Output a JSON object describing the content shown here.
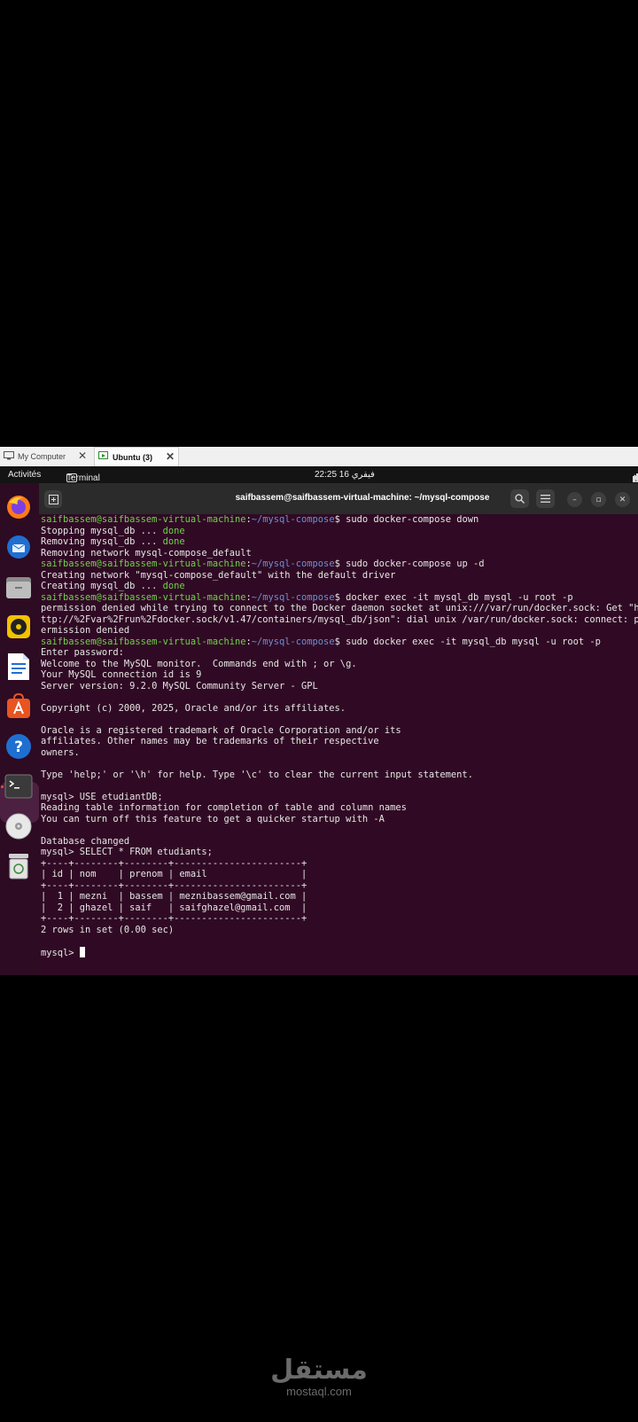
{
  "vm_tabs": [
    {
      "label": "My Computer",
      "icon": "monitor-icon"
    },
    {
      "label": "Ubuntu (3)",
      "icon": "vm-running-icon"
    }
  ],
  "topbar": {
    "activities": "Activités",
    "app_name": "Terminal",
    "clock": "22:25  16 فيفري",
    "tray_icons": [
      "network-icon",
      "volume-icon",
      "power-icon"
    ]
  },
  "dock": {
    "items": [
      "firefox-icon",
      "thunderbird-icon",
      "files-icon",
      "rhythmbox-icon",
      "writer-icon",
      "app-center-icon",
      "help-icon",
      "terminal-icon",
      "dvd-icon",
      "trash-icon"
    ],
    "active": "terminal-icon"
  },
  "terminal": {
    "title": "saifbassem@saifbassem-virtual-machine: ~/mysql-compose",
    "prompt_user": "saifbassem@saifbassem-virtual-machine",
    "prompt_path": "~/mysql-compose",
    "lines": [
      {
        "type": "prompt",
        "cmd": "sudo docker-compose down"
      },
      {
        "type": "status",
        "text": "Stopping mysql_db ... ",
        "status": "done"
      },
      {
        "type": "status",
        "text": "Removing mysql_db ... ",
        "status": "done"
      },
      {
        "type": "out",
        "text": "Removing network mysql-compose_default"
      },
      {
        "type": "prompt",
        "cmd": "sudo docker-compose up -d"
      },
      {
        "type": "out",
        "text": "Creating network \"mysql-compose_default\" with the default driver"
      },
      {
        "type": "status",
        "text": "Creating mysql_db ... ",
        "status": "done"
      },
      {
        "type": "prompt",
        "cmd": "docker exec -it mysql_db mysql -u root -p"
      },
      {
        "type": "out",
        "text": "permission denied while trying to connect to the Docker daemon socket at unix:///var/run/docker.sock: Get \"h"
      },
      {
        "type": "out",
        "text": "ttp://%2Fvar%2Frun%2Fdocker.sock/v1.47/containers/mysql_db/json\": dial unix /var/run/docker.sock: connect: p"
      },
      {
        "type": "out",
        "text": "ermission denied"
      },
      {
        "type": "prompt",
        "cmd": "sudo docker exec -it mysql_db mysql -u root -p"
      },
      {
        "type": "out",
        "text": "Enter password:"
      },
      {
        "type": "out",
        "text": "Welcome to the MySQL monitor.  Commands end with ; or \\g."
      },
      {
        "type": "out",
        "text": "Your MySQL connection id is 9"
      },
      {
        "type": "out",
        "text": "Server version: 9.2.0 MySQL Community Server - GPL"
      },
      {
        "type": "out",
        "text": ""
      },
      {
        "type": "out",
        "text": "Copyright (c) 2000, 2025, Oracle and/or its affiliates."
      },
      {
        "type": "out",
        "text": ""
      },
      {
        "type": "out",
        "text": "Oracle is a registered trademark of Oracle Corporation and/or its"
      },
      {
        "type": "out",
        "text": "affiliates. Other names may be trademarks of their respective"
      },
      {
        "type": "out",
        "text": "owners."
      },
      {
        "type": "out",
        "text": ""
      },
      {
        "type": "out",
        "text": "Type 'help;' or '\\h' for help. Type '\\c' to clear the current input statement."
      },
      {
        "type": "out",
        "text": ""
      },
      {
        "type": "out",
        "text": "mysql> USE etudiantDB;"
      },
      {
        "type": "out",
        "text": "Reading table information for completion of table and column names"
      },
      {
        "type": "out",
        "text": "You can turn off this feature to get a quicker startup with -A"
      },
      {
        "type": "out",
        "text": ""
      },
      {
        "type": "out",
        "text": "Database changed"
      },
      {
        "type": "out",
        "text": "mysql> SELECT * FROM etudiants;"
      },
      {
        "type": "out",
        "text": "+----+--------+--------+-----------------------+"
      },
      {
        "type": "out",
        "text": "| id | nom    | prenom | email                 |"
      },
      {
        "type": "out",
        "text": "+----+--------+--------+-----------------------+"
      },
      {
        "type": "out",
        "text": "|  1 | mezni  | bassem | meznibassem@gmail.com |"
      },
      {
        "type": "out",
        "text": "|  2 | ghazel | saif   | saifghazel@gmail.com  |"
      },
      {
        "type": "out",
        "text": "+----+--------+--------+-----------------------+"
      },
      {
        "type": "out",
        "text": "2 rows in set (0.00 sec)"
      },
      {
        "type": "out",
        "text": ""
      },
      {
        "type": "input",
        "text": "mysql> "
      }
    ]
  },
  "watermark": {
    "arabic": "مستقل",
    "latin": "mostaql.com"
  }
}
